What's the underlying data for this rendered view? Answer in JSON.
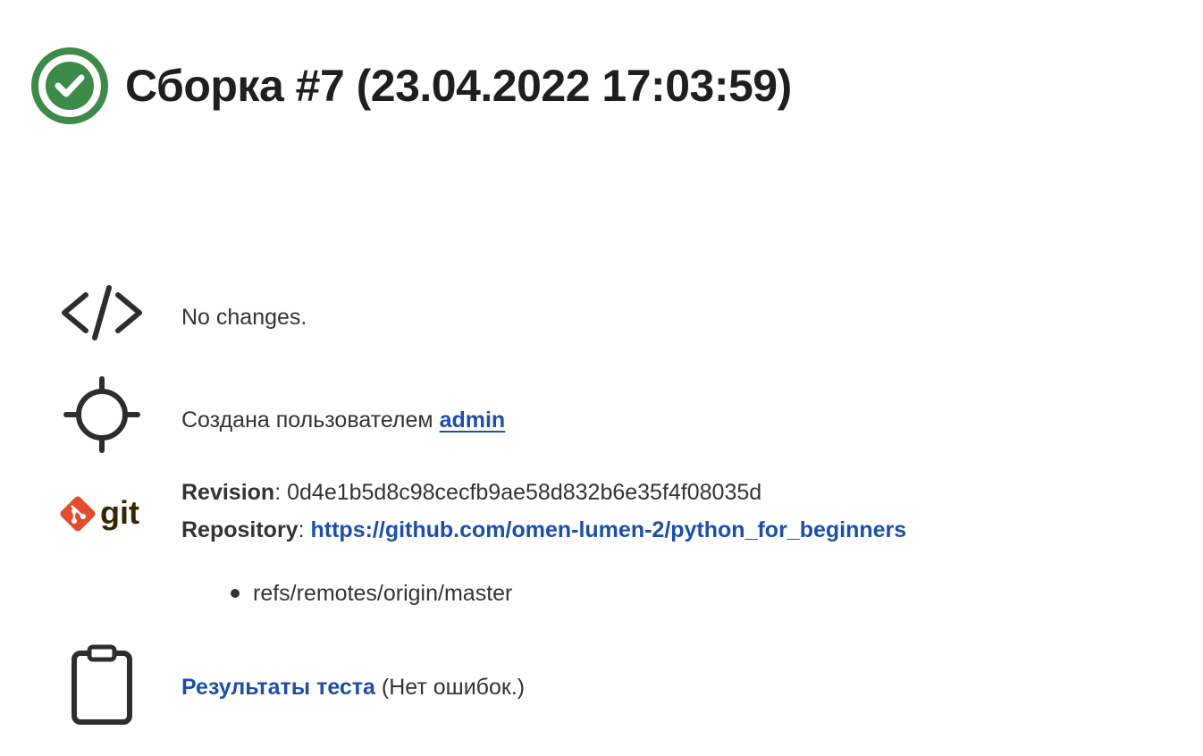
{
  "build": {
    "status": "success",
    "status_color": "#3d8b48",
    "title": "Сборка #7 (23.04.2022 17:03:59)"
  },
  "changes": {
    "icon": "code-icon",
    "text": "No changes."
  },
  "cause": {
    "icon": "crosshair-icon",
    "prefix": "Создана пользователем ",
    "user_link": "admin"
  },
  "git": {
    "icon": "git-logo",
    "logo_color": "#e44c30",
    "logo_text": "git",
    "revision_label": "Revision",
    "revision_value": "0d4e1b5d8c98cecfb9ae58d832b6e35f4f08035d",
    "repository_label": "Repository",
    "repository_link": "https://github.com/omen-lumen-2/python_for_beginners",
    "refs": [
      "refs/remotes/origin/master"
    ]
  },
  "tests": {
    "icon": "clipboard-icon",
    "link_text": "Результаты теста",
    "suffix": " (Нет ошибок.)"
  },
  "colors": {
    "link": "#1e4fa8",
    "text": "#333333",
    "heading": "#1f1f1f"
  }
}
